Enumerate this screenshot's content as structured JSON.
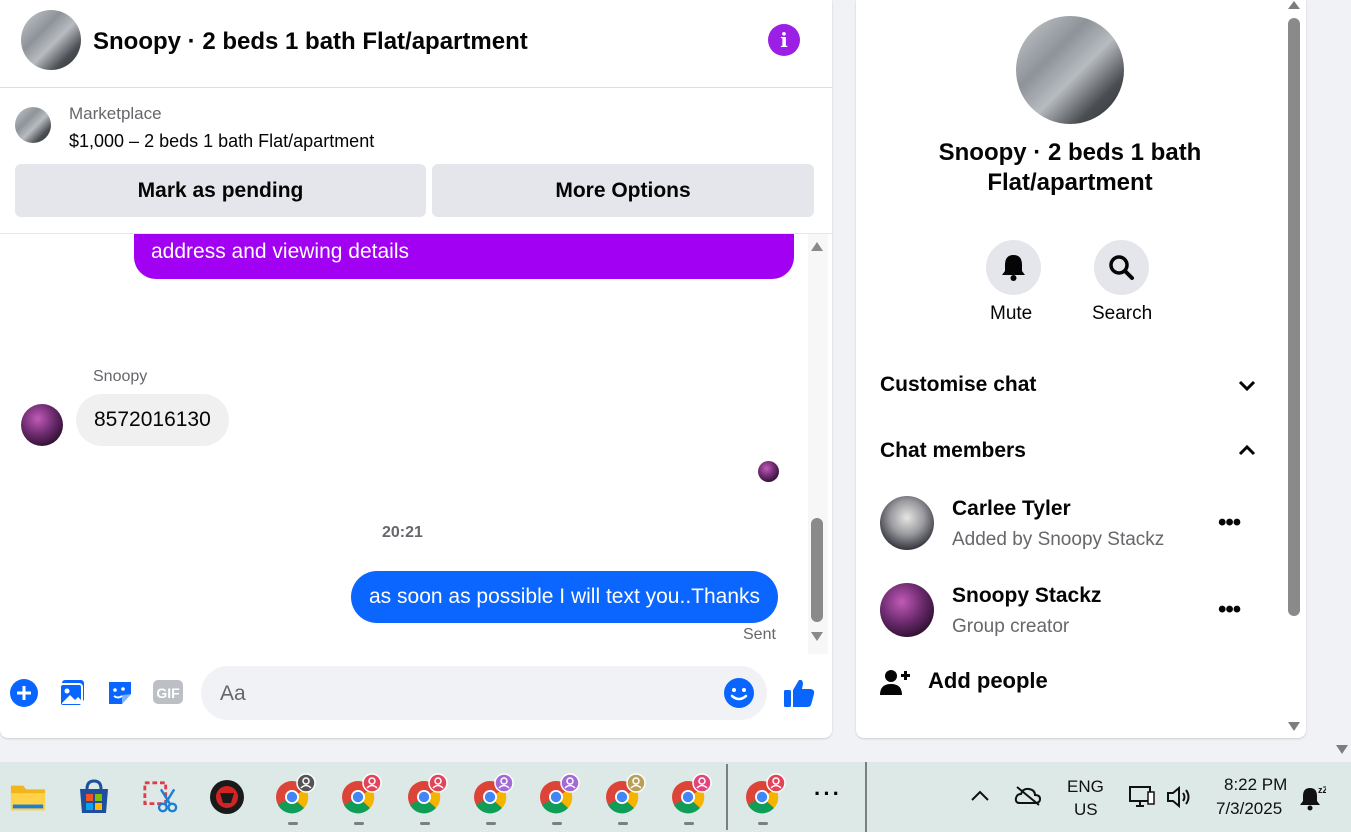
{
  "header": {
    "title": "Snoopy · 2 beds 1 bath Flat/apartment"
  },
  "marketplace": {
    "label": "Marketplace",
    "listing": "$1,000 – 2 beds 1 bath Flat/apartment",
    "mark_pending": "Mark as pending",
    "more_options": "More Options"
  },
  "messages": {
    "outgoing_partial": "address and viewing details",
    "sender_name": "Snoopy",
    "incoming_text": "8572016130",
    "timestamp": "20:21",
    "outgoing_text": "as soon as possible I will text you..Thanks",
    "status": "Sent"
  },
  "composer": {
    "placeholder": "Aa"
  },
  "sidebar": {
    "title": "Snoopy · 2 beds 1 bath Flat/apartment",
    "mute_label": "Mute",
    "search_label": "Search",
    "customise_chat": "Customise chat",
    "chat_members": "Chat members",
    "members": [
      {
        "name": "Carlee Tyler",
        "subtitle": "Added by Snoopy Stackz"
      },
      {
        "name": "Snoopy Stackz",
        "subtitle": "Group creator"
      }
    ],
    "add_people": "Add people"
  },
  "taskbar": {
    "language": "ENG",
    "region": "US",
    "time": "8:22 PM",
    "date": "7/3/2025",
    "more": "···"
  },
  "colors": {
    "purple_bubble": "#a100f2",
    "blue_bubble": "#0a66ff",
    "accent": "#0866ff"
  }
}
